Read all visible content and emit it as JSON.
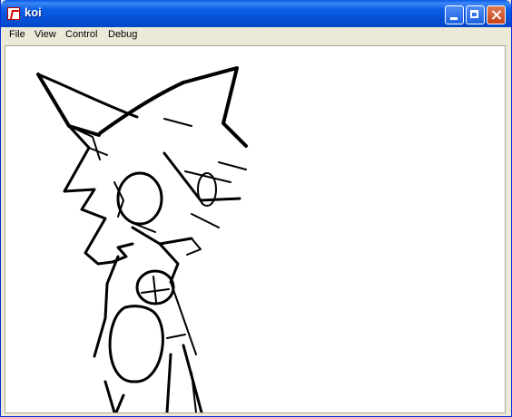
{
  "window": {
    "title": "koi"
  },
  "menubar": {
    "items": [
      "File",
      "View",
      "Control",
      "Debug"
    ]
  },
  "titlebar_buttons": [
    "minimize",
    "maximize",
    "close"
  ],
  "colors": {
    "titlebar": "#0a5ee6",
    "close_button": "#c6431a",
    "chrome": "#ece9d8",
    "canvas": "#ffffff",
    "ink": "#000000"
  }
}
